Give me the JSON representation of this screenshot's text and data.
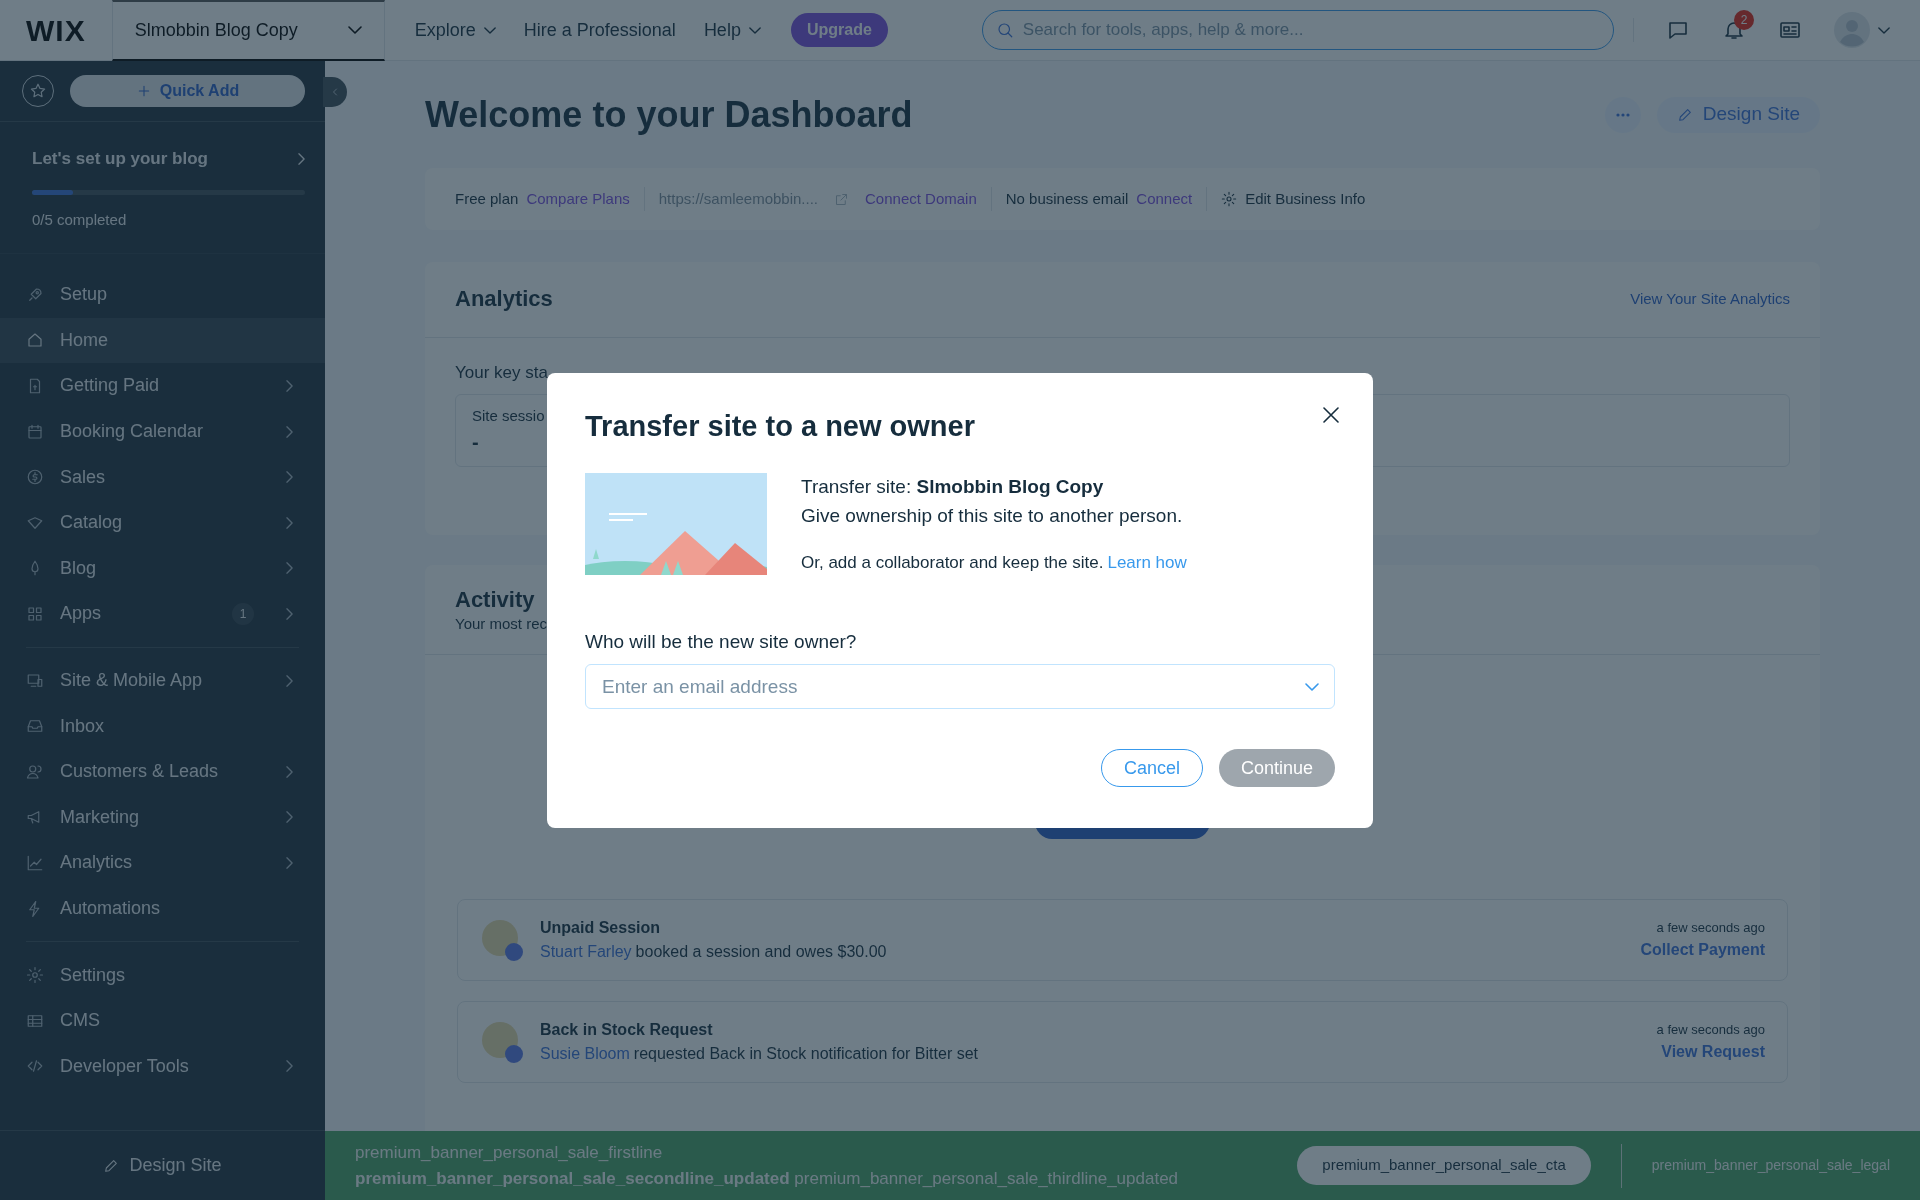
{
  "topbar": {
    "logo": "WIX",
    "site_selector": "Slmobbin Blog Copy",
    "nav": [
      {
        "label": "Explore",
        "dropdown": true
      },
      {
        "label": "Hire a Professional",
        "dropdown": false
      },
      {
        "label": "Help",
        "dropdown": true
      }
    ],
    "upgrade": "Upgrade",
    "search": {
      "placeholder": "Search for tools, apps, help & more..."
    },
    "notification_count": "2"
  },
  "sidebar": {
    "quick_add": "Quick Add",
    "setup": {
      "title": "Let's set up your blog",
      "level": 0.15,
      "progress_text": "0/5 completed"
    },
    "groups": [
      [
        {
          "label": "Setup",
          "selected": false,
          "expandable": false
        },
        {
          "label": "Home",
          "selected": true,
          "expandable": false
        },
        {
          "label": "Getting Paid",
          "selected": false,
          "expandable": true
        },
        {
          "label": "Booking Calendar",
          "selected": false,
          "expandable": true
        },
        {
          "label": "Sales",
          "selected": false,
          "expandable": true
        },
        {
          "label": "Catalog",
          "selected": false,
          "expandable": true
        },
        {
          "label": "Blog",
          "selected": false,
          "expandable": true
        },
        {
          "label": "Apps",
          "selected": false,
          "expandable": true,
          "badge": "1"
        }
      ],
      [
        {
          "label": "Site & Mobile App",
          "selected": false,
          "expandable": true
        },
        {
          "label": "Inbox",
          "selected": false,
          "expandable": false
        },
        {
          "label": "Customers & Leads",
          "selected": false,
          "expandable": true
        },
        {
          "label": "Marketing",
          "selected": false,
          "expandable": true
        },
        {
          "label": "Analytics",
          "selected": false,
          "expandable": true
        },
        {
          "label": "Automations",
          "selected": false,
          "expandable": false
        }
      ],
      [
        {
          "label": "Settings",
          "selected": false,
          "expandable": false
        },
        {
          "label": "CMS",
          "selected": false,
          "expandable": false
        },
        {
          "label": "Developer Tools",
          "selected": false,
          "expandable": true
        }
      ]
    ],
    "design_site": "Design Site"
  },
  "header": {
    "title": "Welcome to your Dashboard",
    "design_site": "Design Site"
  },
  "info_bar": {
    "plan": "Free plan",
    "compare_plans": "Compare Plans",
    "site_url": "https://samleemobbin....",
    "connect_domain": "Connect Domain",
    "email_text": "No business email",
    "connect": "Connect",
    "edit_business_info": "Edit Business Info"
  },
  "analytics": {
    "title": "Analytics",
    "link": "View Your Site Analytics",
    "text": "Your key sta",
    "stat_label": "Site sessio",
    "stat_value": "-"
  },
  "activity": {
    "title": "Activity",
    "subtitle": "Your most rec",
    "items": [
      {
        "title": "Unpaid Session",
        "person": "Stuart Farley",
        "text": "booked a session and owes $30.00",
        "time": "a few seconds ago",
        "action": "Collect Payment"
      },
      {
        "title": "Back in Stock Request",
        "person": "Susie Bloom",
        "text": "requested Back in Stock notification for Bitter set",
        "time": "a few seconds ago",
        "action": "View Request"
      }
    ]
  },
  "modal": {
    "title": "Transfer site to a new owner",
    "transfer_text": "Transfer site: **Slmobbin Blog Copy**",
    "description": "Give ownership of this site to another person.",
    "collaborator_text": "Or, add a collaborator and keep the site.",
    "learn_how": "Learn how",
    "field_label": "Who will be the new site owner?",
    "placeholder": "Enter an email address",
    "cancel": "Cancel",
    "continue": {
      "label": "Continue",
      "disabled": true
    }
  },
  "banner": {
    "line1": "premium_banner_personal_sale_firstline",
    "line2": "**premium_banner_personal_sale_secondline_updated** premium_banner_personal_sale_thirdline_updated",
    "cta": "premium_banner_personal_sale_cta",
    "legal": "premium_banner_personal_sale_legal"
  }
}
